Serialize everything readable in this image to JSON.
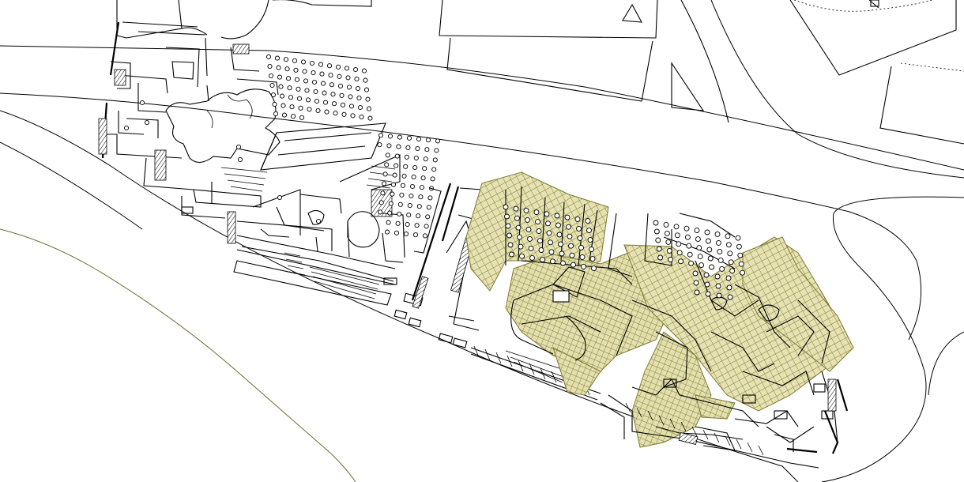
{
  "diagram": {
    "kind": "architectural site plan",
    "colors": {
      "background": "#ffffff",
      "linework": "#000000",
      "canopy_fill": "#e6e2b3",
      "canopy_grid": "#7d7a32",
      "riverbank": "#6b6b2a"
    },
    "regions": [
      {
        "name": "western-complex"
      },
      {
        "name": "eastern-complex-with-canopy"
      },
      {
        "name": "city-blocks-north"
      },
      {
        "name": "riverbank-southwest"
      }
    ]
  }
}
